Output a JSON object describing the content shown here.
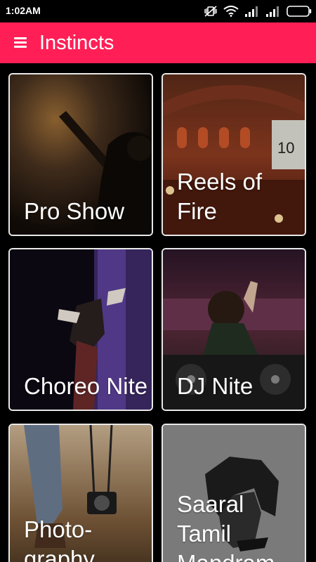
{
  "status_bar": {
    "time": "1:02AM",
    "icons": [
      "vibrate-off-icon",
      "wifi-icon",
      "signal-icon",
      "signal-icon",
      "battery-icon"
    ]
  },
  "app_bar": {
    "title": "Instincts",
    "menu_icon": "hamburger-menu-icon",
    "background": "#ff1f56"
  },
  "cards": [
    {
      "label": "Pro Show"
    },
    {
      "label": "Reels of\nFire"
    },
    {
      "label": "Choreo Nite"
    },
    {
      "label": "DJ Nite"
    },
    {
      "label": "Photo-\ngraphy"
    },
    {
      "label": "Saaral\nTamil\nMandram"
    }
  ]
}
